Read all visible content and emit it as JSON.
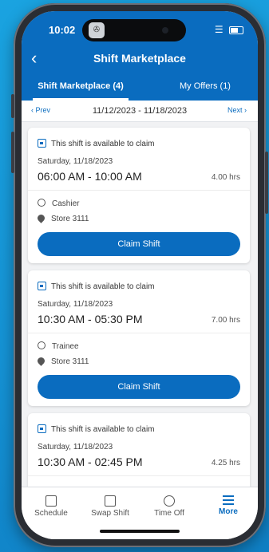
{
  "status_bar": {
    "time": "10:02",
    "camera_glyph": "✇",
    "signal": "•••"
  },
  "header": {
    "title": "Shift Marketplace",
    "back_icon": "chevron-left-icon",
    "tabs": [
      {
        "label": "Shift Marketplace (4)",
        "active": true
      },
      {
        "label": "My Offers (1)",
        "active": false
      }
    ]
  },
  "date_nav": {
    "prev_label": "‹ Prev",
    "next_label": "Next ›",
    "range": "11/12/2023 - 11/18/2023"
  },
  "shifts": [
    {
      "available_text": "This shift is available to claim",
      "date": "Saturday, 11/18/2023",
      "time_range": "06:00 AM - 10:00 AM",
      "hours": "4.00 hrs",
      "role": "Cashier",
      "store": "Store 3111",
      "action_label": "Claim Shift"
    },
    {
      "available_text": "This shift is available to claim",
      "date": "Saturday, 11/18/2023",
      "time_range": "10:30 AM - 05:30 PM",
      "hours": "7.00 hrs",
      "role": "Trainee",
      "store": "Store 3111",
      "action_label": "Claim Shift"
    },
    {
      "available_text": "This shift is available to claim",
      "date": "Saturday, 11/18/2023",
      "time_range": "10:30 AM - 02:45 PM",
      "hours": "4.25 hrs"
    }
  ],
  "bottom_nav": [
    {
      "label": "Schedule",
      "icon": "calendar-icon"
    },
    {
      "label": "Swap Shift",
      "icon": "swap-icon"
    },
    {
      "label": "Time Off",
      "icon": "beach-umbrella-icon"
    },
    {
      "label": "More",
      "icon": "hamburger-menu-icon",
      "active": true
    }
  ],
  "colors": {
    "primary": "#0a6cbf",
    "background": "#f1f2f4"
  }
}
